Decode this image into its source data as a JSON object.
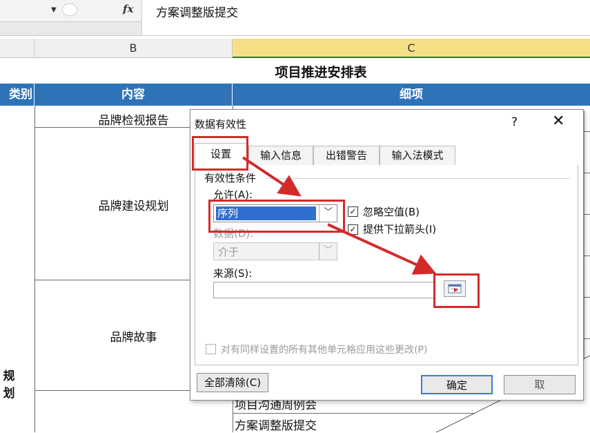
{
  "formula_bar": {
    "fx_label": "fx",
    "formula_value": "方案调整版提交"
  },
  "columns": [
    "B",
    "C"
  ],
  "sheet": {
    "title": "项目推进安排表",
    "headers": {
      "category": "类别",
      "content": "内容",
      "detail": "细项"
    },
    "content_cells": [
      "品牌检视报告",
      "品牌建设规划",
      "品牌故事"
    ],
    "category_cell": "规划",
    "detail_cells": [
      "项目沟通周例会",
      "方案调整版提交"
    ]
  },
  "dialog": {
    "title": "数据有效性",
    "help": "?",
    "close": "✕",
    "tabs": [
      "设置",
      "输入信息",
      "出错警告",
      "输入法模式"
    ],
    "group_label": "有效性条件",
    "allow_label": "允许(A):",
    "allow_value": "序列",
    "data_label": "数据(D):",
    "data_value": "介于",
    "ignore_blank": "忽略空值(B)",
    "dropdown_arrow": "提供下拉箭头(I)",
    "source_label": "来源(S):",
    "source_value": "",
    "apply_all": "对有同样设置的所有其他单元格应用这些更改(P)",
    "clear_button": "全部清除(C)",
    "ok_button": "确定",
    "cancel_button": "取"
  },
  "colors": {
    "header_blue": "#2e72b8",
    "annotation_red": "#d42a2a",
    "selected_column": "#f6df86"
  }
}
